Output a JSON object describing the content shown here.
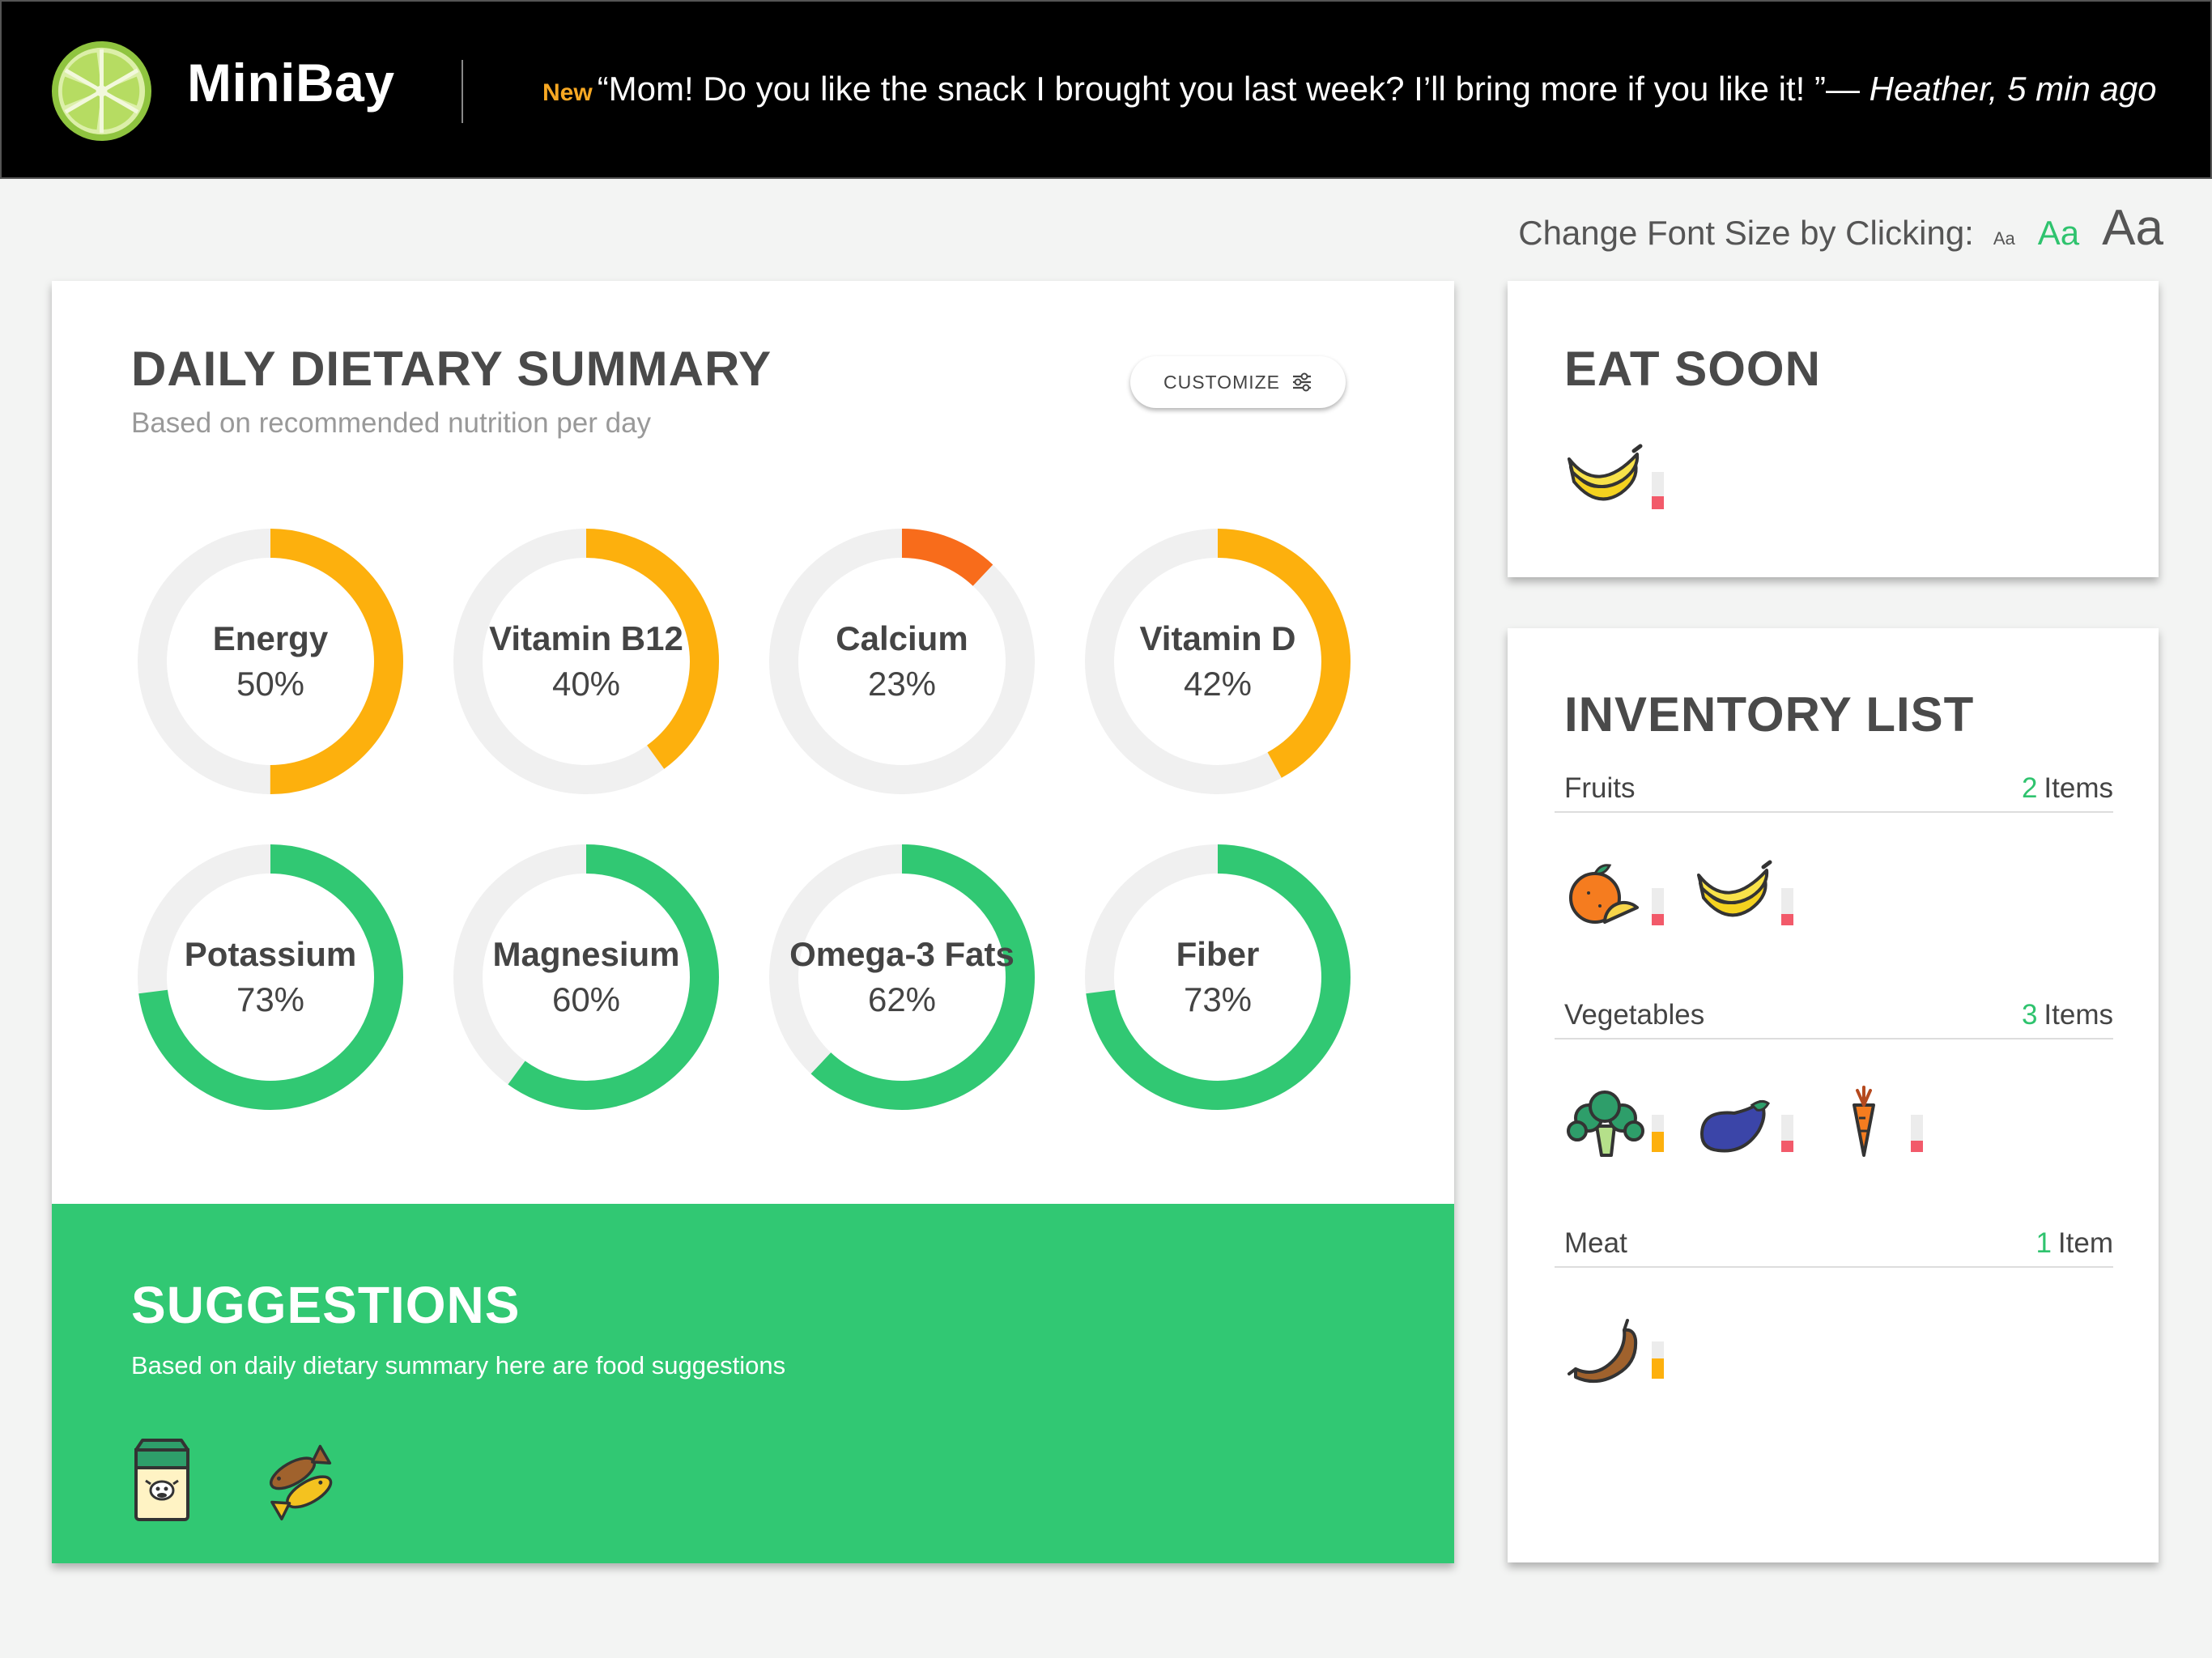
{
  "header": {
    "brand": "MiniBay",
    "ticker_new": "New",
    "ticker_quote": "“Mom! Do you like the snack I brought you last week? I’ll bring more if you like it! ”",
    "ticker_dash": "— ",
    "ticker_who": "Heather, 5 min ago"
  },
  "font_size": {
    "label": "Change Font Size by Clicking:",
    "options": [
      "Aa",
      "Aa",
      "Aa"
    ],
    "selected": 1
  },
  "summary": {
    "title": "DAILY DIETARY SUMMARY",
    "subtitle": "Based on recommended nutrition per day",
    "customize_label": "CUSTOMIZE",
    "nutrients": [
      {
        "name": "Energy",
        "percent": 50,
        "value_text": "50%",
        "color": "#fdb00d"
      },
      {
        "name": "Vitamin B12",
        "percent": 40,
        "value_text": "40%",
        "color": "#fdb00d"
      },
      {
        "name": "Calcium",
        "percent": 12,
        "value_text": "23%",
        "color": "#f86c1b"
      },
      {
        "name": "Vitamin D",
        "percent": 42,
        "value_text": "42%",
        "color": "#fdb00d"
      },
      {
        "name": "Potassium",
        "percent": 73,
        "value_text": "73%",
        "color": "#31c873"
      },
      {
        "name": "Magnesium",
        "percent": 60,
        "value_text": "60%",
        "color": "#31c873"
      },
      {
        "name": "Omega-3 Fats",
        "percent": 62,
        "value_text": "62%",
        "color": "#31c873"
      },
      {
        "name": "Fiber",
        "percent": 73,
        "value_text": "73%",
        "color": "#31c873"
      }
    ],
    "track_color": "#f0f0f0"
  },
  "suggestions": {
    "title": "SUGGESTIONS",
    "subtitle": "Based on daily dietary summary here are food suggestions",
    "items": [
      "milk-carton-icon",
      "fish-icon"
    ]
  },
  "eat_soon": {
    "title": "EAT SOON",
    "items": [
      {
        "icon": "banana-icon",
        "level": 0.35,
        "level_color": "#f25a6a"
      }
    ]
  },
  "inventory": {
    "title": "INVENTORY LIST",
    "categories": [
      {
        "name": "Fruits",
        "count": "2",
        "unit": "Items",
        "items": [
          {
            "icon": "orange-icon",
            "level": 0.3,
            "level_color": "#f25a6a"
          },
          {
            "icon": "banana-icon",
            "level": 0.3,
            "level_color": "#f25a6a"
          }
        ]
      },
      {
        "name": "Vegetables",
        "count": "3",
        "unit": "Items",
        "items": [
          {
            "icon": "broccoli-icon",
            "level": 0.55,
            "level_color": "#fdb00d"
          },
          {
            "icon": "eggplant-icon",
            "level": 0.3,
            "level_color": "#f25a6a"
          },
          {
            "icon": "carrot-icon",
            "level": 0.3,
            "level_color": "#f25a6a"
          }
        ]
      },
      {
        "name": "Meat",
        "count": "1",
        "unit": "Item",
        "items": [
          {
            "icon": "sausage-icon",
            "level": 0.55,
            "level_color": "#fdb00d"
          }
        ]
      }
    ]
  }
}
